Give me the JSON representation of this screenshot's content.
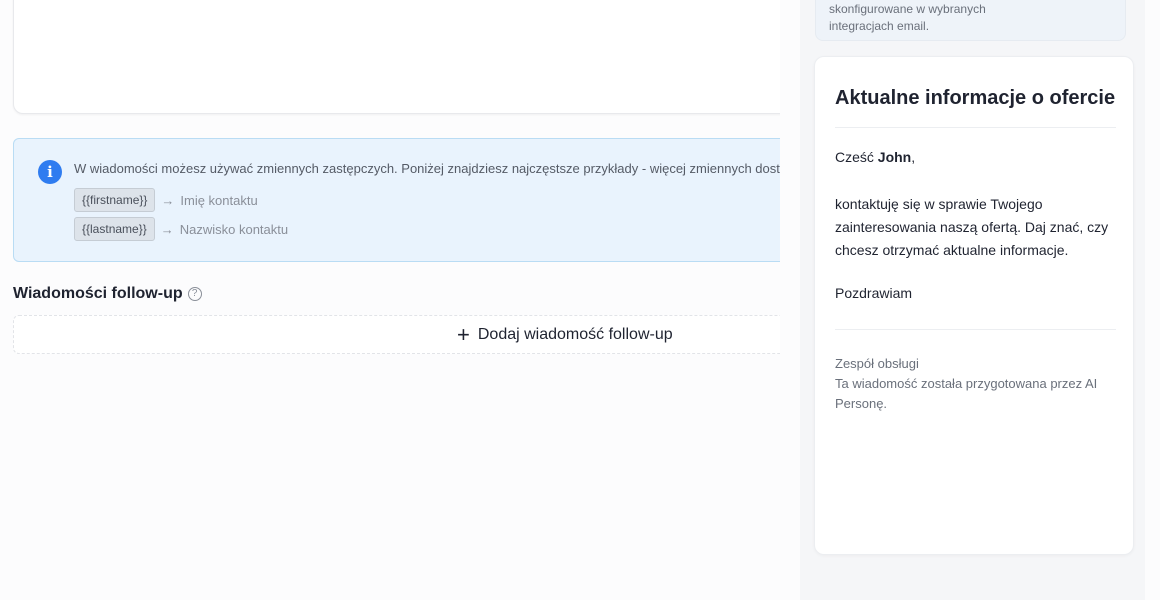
{
  "info": {
    "message": "W wiadomości możesz używać zmiennych zastępczych. Poniżej znajdziesz najczęstsze przykłady - więcej zmiennych dostępnych",
    "variables": [
      {
        "token": "{{firstname}}",
        "arrow": "→",
        "description": "Imię kontaktu"
      },
      {
        "token": "{{lastname}}",
        "arrow": "→",
        "description": "Nazwisko kontaktu"
      }
    ]
  },
  "followup": {
    "title": "Wiadomości follow-up",
    "help_icon": "?",
    "add_icon": "+",
    "add_label": "Dodaj wiadomość follow-up"
  },
  "side": {
    "note": "skonfigurowane w wybranych integracjach email.",
    "preview": {
      "subject": "Aktualne informacje o ofercie",
      "greeting_prefix": "Cześć ",
      "greeting_name": "John",
      "greeting_suffix": ",",
      "body": "kontaktuję się w sprawie Twojego zainteresowania naszą ofertą. Daj znać, czy chcesz otrzymać aktualne informacje.",
      "closing": "Pozdrawiam",
      "signature_team": "Zespół obsługi",
      "signature_note": "Ta wiadomość została przygotowana przez AI Personę."
    }
  },
  "colors": {
    "info_bg": "#e9f3fd",
    "info_border": "#b9dcf4",
    "info_icon": "#2f7cf0",
    "chip_bg": "#dde3ea"
  },
  "icons": {
    "info": "info-icon",
    "help": "question-circle-icon",
    "add": "plus-icon",
    "arrow": "arrow-right-icon"
  }
}
